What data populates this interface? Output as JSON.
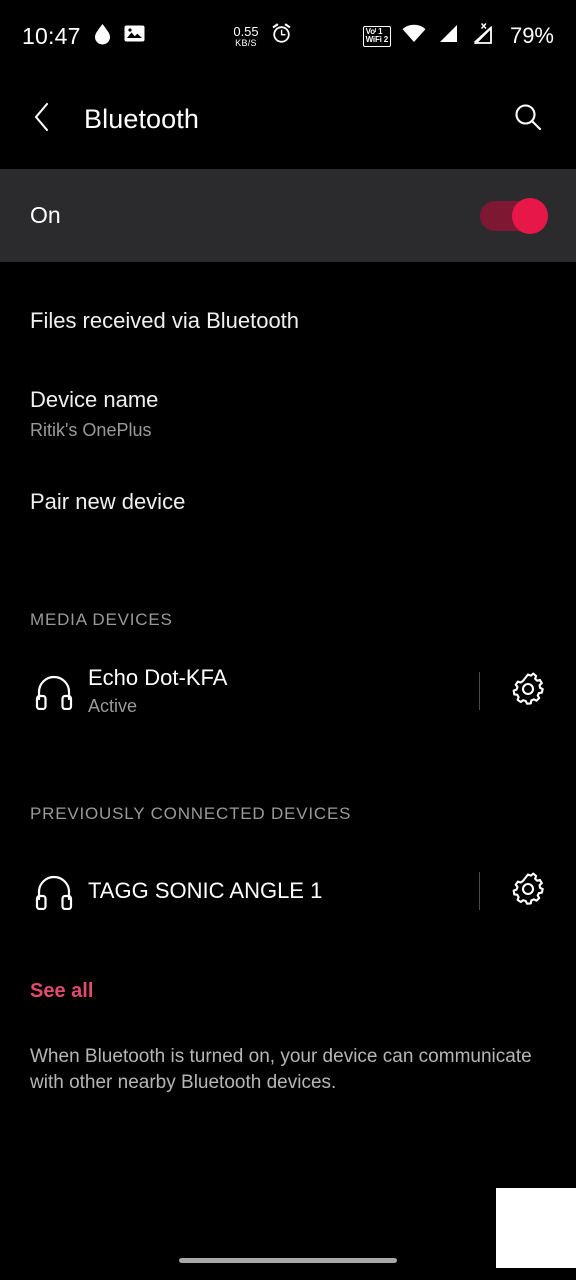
{
  "status_bar": {
    "time": "10:47",
    "left_icons": [
      "water-drop-icon",
      "photo-icon"
    ],
    "network_speed_value": "0.55",
    "network_speed_unit": "KB/S",
    "alarm_icon": "alarm-clock-icon",
    "vowifi_line1": "Voᴵ 1",
    "vowifi_line2": "WiFi 2",
    "wifi_icon": "wifi-icon",
    "signal_icon": "cellular-signal-icon",
    "signal_off_icon": "cellular-no-service-icon",
    "battery": "79%"
  },
  "app_bar": {
    "back": "back-chevron",
    "title": "Bluetooth",
    "search": "search-icon"
  },
  "master_toggle": {
    "label": "On",
    "state": "on",
    "track_color": "#7e1732",
    "knob_color": "#e8174a"
  },
  "items": {
    "files_received": "Files received via Bluetooth",
    "device_name_title": "Device name",
    "device_name_value": "Ritik's OnePlus",
    "pair_new_device": "Pair new device"
  },
  "sections": [
    {
      "header": "MEDIA DEVICES",
      "devices": [
        {
          "name": "Echo Dot-KFA",
          "state": "Active",
          "icon": "headphones-icon",
          "settings_icon": "gear-icon"
        }
      ]
    },
    {
      "header": "PREVIOUSLY CONNECTED DEVICES",
      "devices": [
        {
          "name": "TAGG SONIC ANGLE 1",
          "state": "",
          "icon": "headphones-icon",
          "settings_icon": "gear-icon"
        }
      ]
    }
  ],
  "see_all": "See all",
  "footer_note": "When Bluetooth is turned on, your device can communicate with other nearby Bluetooth devices.",
  "accent_color": "#e04a6e"
}
